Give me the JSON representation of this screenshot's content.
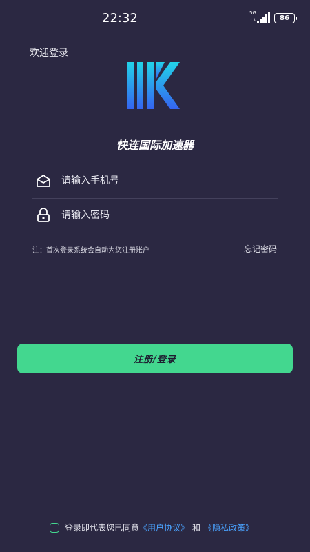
{
  "status_bar": {
    "time": "22:32",
    "network": "5G",
    "battery": "86"
  },
  "header": {
    "welcome": "欢迎登录"
  },
  "brand": {
    "app_name": "快连国际加速器"
  },
  "form": {
    "phone_placeholder": "请输入手机号",
    "password_placeholder": "请输入密码",
    "note": "注：首次登录系统会自动为您注册账户",
    "forgot_label": "忘记密码"
  },
  "login_button_label": "注册/登录",
  "agreement": {
    "text": "登录即代表您已同意",
    "user_agreement_link": "《用户协议》",
    "and": "和",
    "privacy_link": "《隐私政策》"
  },
  "colors": {
    "background": "#2b2842",
    "accent": "#43d78f",
    "link": "#4aa3ff"
  }
}
